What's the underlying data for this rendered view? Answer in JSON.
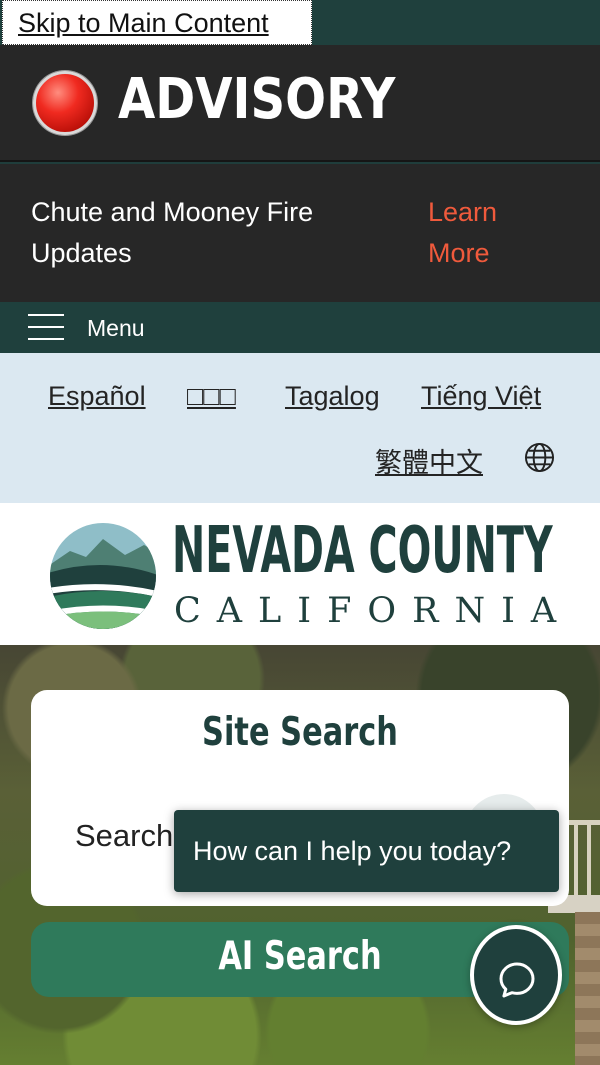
{
  "skip_link": "Skip to Main Content",
  "advisory": {
    "title": "ADVISORY",
    "icon": "alert-red-dot-icon"
  },
  "notice": {
    "text": "Chute and Mooney Fire Updates",
    "link": "Learn More",
    "link_color": "#f05a3c"
  },
  "menu": {
    "label": "Menu",
    "icon": "hamburger-icon"
  },
  "languages": [
    "Español",
    "□□□",
    "Tagalog",
    "Tiếng Việt",
    "繁體中文"
  ],
  "language_icon": "globe-icon",
  "logo": {
    "name": "NEVADA COUNTY",
    "state": "CALIFORNIA"
  },
  "search": {
    "title": "Site Search",
    "label": "Search",
    "button_icon": "search-icon"
  },
  "ai_search": {
    "label": "AI Search"
  },
  "chat": {
    "tooltip": "How can I help you today?",
    "icon": "chat-bubble-icon"
  },
  "colors": {
    "brand_green": "#1f403d",
    "accent_green": "#2f7a5b",
    "advisory_bg": "#272727",
    "language_bg": "#dbe8f1"
  }
}
